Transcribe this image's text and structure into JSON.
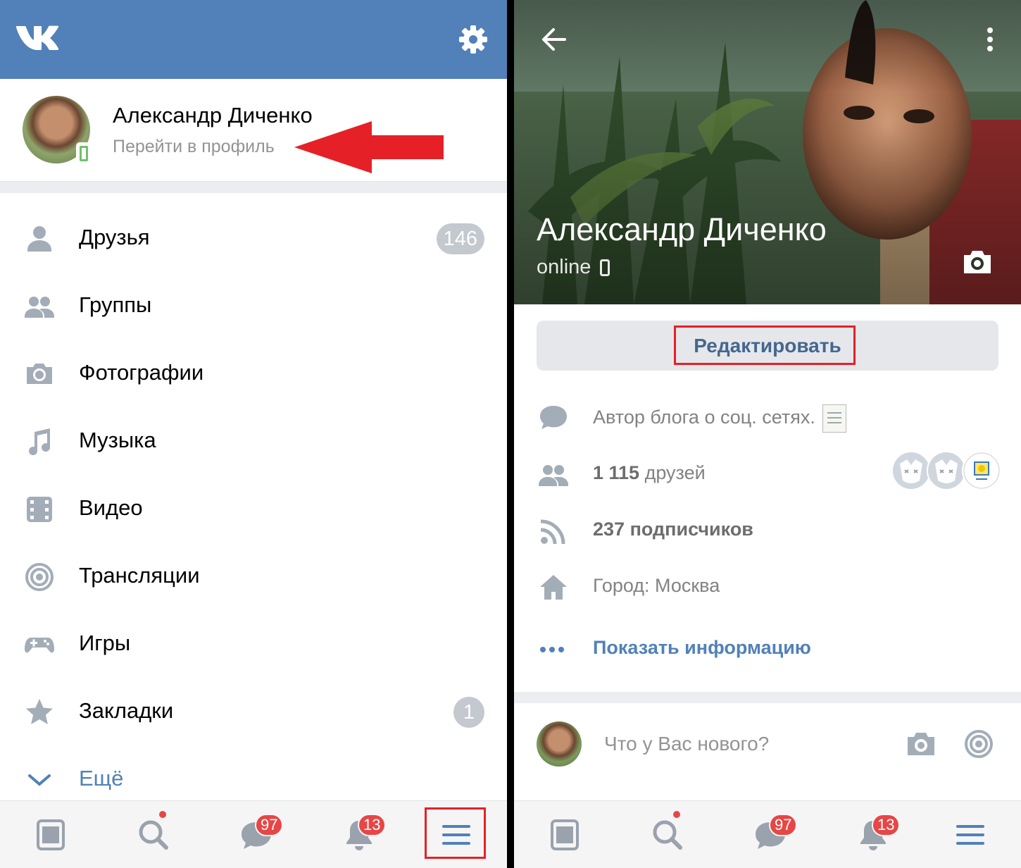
{
  "left": {
    "header": {
      "logo": "VK",
      "settings_icon": "gear-icon"
    },
    "profile": {
      "name": "Александр Диченко",
      "link": "Перейти в профиль"
    },
    "menu": [
      {
        "label": "Друзья",
        "icon": "user-icon",
        "badge": "146"
      },
      {
        "label": "Группы",
        "icon": "users-icon",
        "badge": ""
      },
      {
        "label": "Фотографии",
        "icon": "camera-icon",
        "badge": ""
      },
      {
        "label": "Музыка",
        "icon": "music-note-icon",
        "badge": ""
      },
      {
        "label": "Видео",
        "icon": "video-icon",
        "badge": ""
      },
      {
        "label": "Трансляции",
        "icon": "broadcast-icon",
        "badge": ""
      },
      {
        "label": "Игры",
        "icon": "gamepad-icon",
        "badge": ""
      },
      {
        "label": "Закладки",
        "icon": "star-icon",
        "badge": "1"
      }
    ],
    "more": "Ещё",
    "tabbar": {
      "messages_badge": "97",
      "notifications_badge": "13"
    }
  },
  "right": {
    "cover": {
      "name": "Александр Диченко",
      "status": "online"
    },
    "edit_button": "Редактировать",
    "info": {
      "status_text": "Автор блога о соц. сетях.",
      "friends_count": "1 115",
      "friends_word": "друзей",
      "followers_count": "237",
      "followers_word": "подписчиков",
      "city": "Город: Москва",
      "show_info": "Показать информацию"
    },
    "post_prompt": "Что у Вас нового?",
    "tabbar": {
      "messages_badge": "97",
      "notifications_badge": "13"
    }
  },
  "colors": {
    "vk_blue": "#5181b8",
    "badge_red": "#e64646",
    "highlight_red": "#e52127",
    "link_blue": "#5181b8"
  }
}
